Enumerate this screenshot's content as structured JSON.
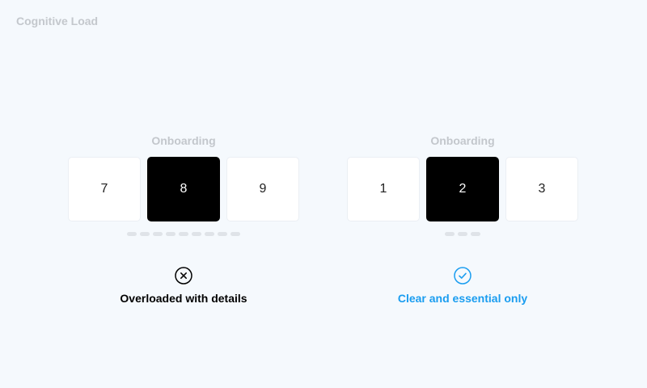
{
  "page": {
    "title": "Cognitive Load"
  },
  "panels": {
    "bad": {
      "title": "Onboarding",
      "steps": [
        "7",
        "8",
        "9"
      ],
      "active_step": "8",
      "dot_count": 9,
      "icon": "close-circle-icon",
      "label": "Overloaded with details",
      "color": "#000000"
    },
    "good": {
      "title": "Onboarding",
      "steps": [
        "1",
        "2",
        "3"
      ],
      "active_step": "2",
      "dot_count": 3,
      "icon": "check-circle-icon",
      "label": "Clear and essential only",
      "color": "#1a9df0"
    }
  }
}
